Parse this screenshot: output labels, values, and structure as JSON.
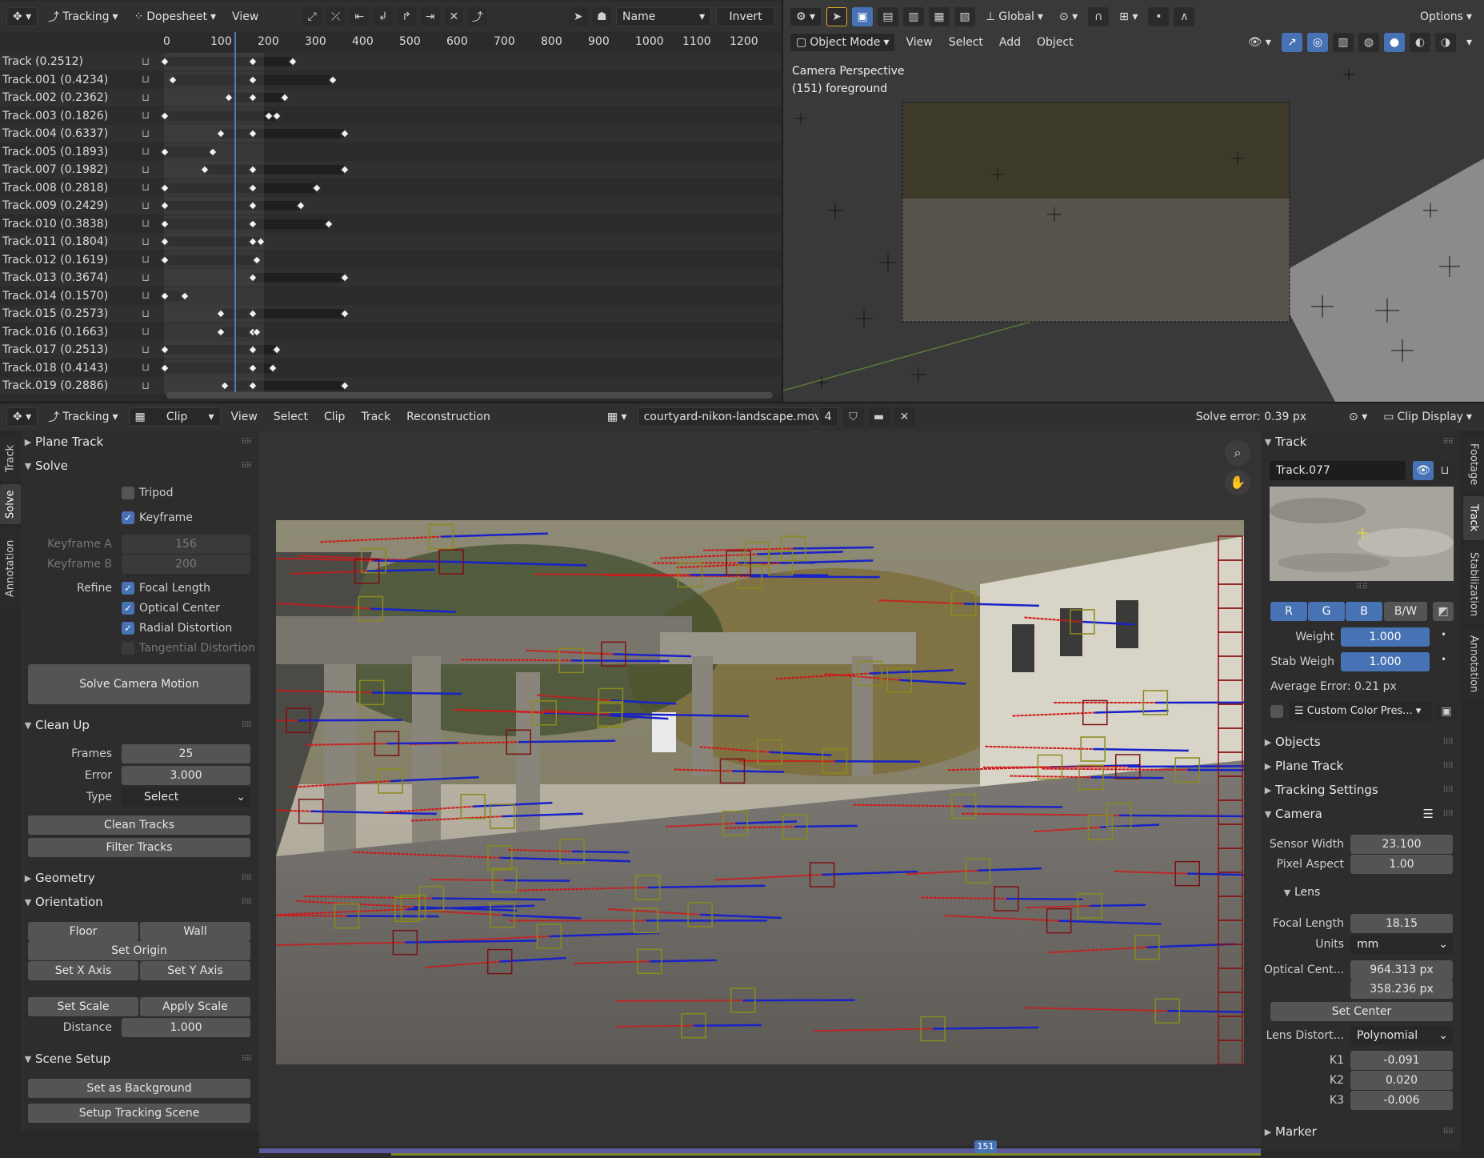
{
  "dopesheet_header": {
    "editor": "Tracking",
    "mode": "Dopesheet",
    "view": "View",
    "sort": "Name",
    "invert": "Invert"
  },
  "timeline_ruler": [
    "0",
    "100",
    "200",
    "300",
    "400",
    "500",
    "600",
    "700",
    "800",
    "900",
    "1000",
    "1100",
    "1200"
  ],
  "tracks": [
    {
      "name": "Track (0.2512)",
      "keys": [
        0,
        110,
        160
      ]
    },
    {
      "name": "Track.001 (0.4234)",
      "keys": [
        10,
        110,
        210
      ]
    },
    {
      "name": "Track.002 (0.2362)",
      "keys": [
        80,
        110,
        150
      ]
    },
    {
      "name": "Track.003 (0.1826)",
      "keys": [
        0,
        130,
        140
      ]
    },
    {
      "name": "Track.004 (0.6337)",
      "keys": [
        70,
        110,
        225
      ]
    },
    {
      "name": "Track.005 (0.1893)",
      "keys": [
        0,
        60
      ]
    },
    {
      "name": "Track.007 (0.1982)",
      "keys": [
        50,
        110,
        225
      ]
    },
    {
      "name": "Track.008 (0.2818)",
      "keys": [
        0,
        110,
        190
      ]
    },
    {
      "name": "Track.009 (0.2429)",
      "keys": [
        0,
        110,
        170
      ]
    },
    {
      "name": "Track.010 (0.3838)",
      "keys": [
        0,
        110,
        205
      ]
    },
    {
      "name": "Track.011 (0.1804)",
      "keys": [
        0,
        110,
        120
      ]
    },
    {
      "name": "Track.012 (0.1619)",
      "keys": [
        0,
        115
      ]
    },
    {
      "name": "Track.013 (0.3674)",
      "keys": [
        110,
        225
      ]
    },
    {
      "name": "Track.014 (0.1570)",
      "keys": [
        0,
        25
      ]
    },
    {
      "name": "Track.015 (0.2573)",
      "keys": [
        70,
        110,
        225
      ]
    },
    {
      "name": "Track.016 (0.1663)",
      "keys": [
        70,
        110,
        115
      ]
    },
    {
      "name": "Track.017 (0.2513)",
      "keys": [
        0,
        110,
        140
      ]
    },
    {
      "name": "Track.018 (0.4143)",
      "keys": [
        0,
        110,
        135
      ]
    },
    {
      "name": "Track.019 (0.2886)",
      "keys": [
        75,
        110,
        225
      ]
    }
  ],
  "viewport_header": {
    "transform": "Global",
    "options": "Options",
    "mode": "Object Mode",
    "menus": [
      "View",
      "Select",
      "Add",
      "Object"
    ]
  },
  "viewport_overlay": {
    "line1": "Camera Perspective",
    "line2": "(151) foreground"
  },
  "clip_header": {
    "editor": "Tracking",
    "mode": "Clip",
    "menus": [
      "View",
      "Select",
      "Clip",
      "Track",
      "Reconstruction"
    ],
    "clip_name": "courtyard-nikon-landscape.mov",
    "users": "4",
    "solve_error": "Solve error: 0.39 px",
    "display": "Clip Display"
  },
  "left_tabs": [
    "Track",
    "Solve",
    "Annotation"
  ],
  "right_tabs": [
    "Footage",
    "Track",
    "Stabilization",
    "Annotation"
  ],
  "solve_panel": {
    "plane_track": "Plane Track",
    "solve": "Solve",
    "tripod": "Tripod",
    "keyframe": "Keyframe",
    "keyframe_a_label": "Keyframe A",
    "keyframe_a": "156",
    "keyframe_b_label": "Keyframe B",
    "keyframe_b": "200",
    "refine": "Refine",
    "focal_length": "Focal Length",
    "optical_center": "Optical Center",
    "radial": "Radial Distortion",
    "tangential": "Tangential Distortion",
    "solve_btn": "Solve Camera Motion",
    "cleanup": "Clean Up",
    "frames_label": "Frames",
    "frames": "25",
    "error_label": "Error",
    "error": "3.000",
    "type_label": "Type",
    "type": "Select",
    "clean_tracks": "Clean Tracks",
    "filter_tracks": "Filter Tracks",
    "geometry": "Geometry",
    "orientation": "Orientation",
    "floor": "Floor",
    "wall": "Wall",
    "set_origin": "Set Origin",
    "set_x": "Set X Axis",
    "set_y": "Set Y Axis",
    "set_scale": "Set Scale",
    "apply_scale": "Apply Scale",
    "distance_label": "Distance",
    "distance": "1.000",
    "scene_setup": "Scene Setup",
    "set_bg": "Set as Background",
    "setup_scene": "Setup Tracking Scene"
  },
  "track_panel": {
    "title": "Track",
    "name": "Track.077",
    "r": "R",
    "g": "G",
    "b": "B",
    "bw": "B/W",
    "weight_label": "Weight",
    "weight": "1.000",
    "stab_label": "Stab Weigh",
    "stab": "1.000",
    "avg_error": "Average Error: 0.21 px",
    "color_preset": "Custom Color Pres...",
    "objects": "Objects",
    "plane_track": "Plane Track",
    "tracking_settings": "Tracking Settings",
    "camera": "Camera",
    "sensor_label": "Sensor Width",
    "sensor": "23.100",
    "pixel_label": "Pixel Aspect",
    "pixel": "1.00",
    "lens": "Lens",
    "focal_label": "Focal Length",
    "focal": "18.15",
    "units_label": "Units",
    "units": "mm",
    "optical_label": "Optical Cent...",
    "optical_x": "964.313 px",
    "optical_y": "358.236 px",
    "set_center": "Set Center",
    "distort_label": "Lens Distort...",
    "distort": "Polynomial",
    "k1_label": "K1",
    "k1": "-0.091",
    "k2_label": "K2",
    "k2": "0.020",
    "k3_label": "K3",
    "k3": "-0.006",
    "marker": "Marker"
  },
  "frame": {
    "current": "151"
  },
  "colors": {
    "accent": "#4772b3",
    "header": "#303030",
    "panel": "#2d2d2d",
    "field": "#545454"
  }
}
